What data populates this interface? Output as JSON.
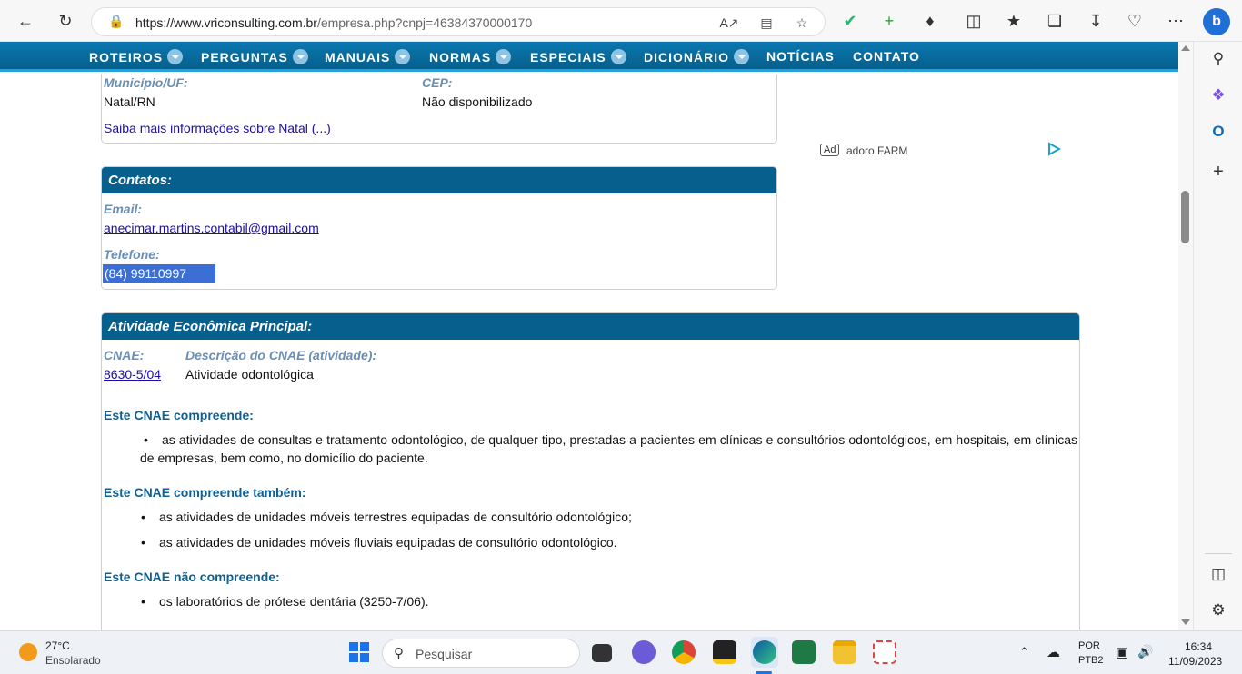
{
  "browser": {
    "url_host": "https://www.vriconsulting.com.br",
    "url_path": "/empresa.php?cnpj=46384370000170"
  },
  "nav": {
    "items": [
      {
        "label": "ROTEIROS",
        "dropdown": true
      },
      {
        "label": "PERGUNTAS",
        "dropdown": true
      },
      {
        "label": "MANUAIS",
        "dropdown": true
      },
      {
        "label": "NORMAS",
        "dropdown": true
      },
      {
        "label": "ESPECIAIS",
        "dropdown": true
      },
      {
        "label": "DICIONÁRIO",
        "dropdown": true
      },
      {
        "label": "NOTÍCIAS",
        "dropdown": false
      },
      {
        "label": "CONTATO",
        "dropdown": false
      }
    ]
  },
  "address": {
    "municipio_label": "Município/UF:",
    "municipio_value": "Natal/RN",
    "cep_label": "CEP:",
    "cep_value": "Não disponibilizado",
    "more_link": "Saiba mais informações sobre Natal (...)"
  },
  "contacts": {
    "title": "Contatos:",
    "email_label": "Email:",
    "email_value": "anecimar.martins.contabil@gmail.com",
    "phone_label": "Telefone:",
    "phone_value": "(84) 99110997"
  },
  "activity": {
    "title": "Atividade Econômica Principal:",
    "cnae_label": "CNAE:",
    "desc_label": "Descrição do CNAE (atividade):",
    "cnae_value": "8630-5/04",
    "desc_value": "Atividade odontológica",
    "comprises_title": "Este CNAE compreende:",
    "comprises": [
      "as atividades de consultas e tratamento odontológico, de qualquer tipo, prestadas a pacientes em clínicas e consultórios odontológicos, em hospitais, em clínicas de empresas, bem como, no domicílio do paciente."
    ],
    "also_title": "Este CNAE compreende também:",
    "also": [
      "as atividades de unidades móveis terrestres equipadas de consultório odontológico;",
      "as atividades de unidades móveis fluviais equipadas de consultório odontológico."
    ],
    "not_title": "Este CNAE não compreende:",
    "not": [
      "os laboratórios de prótese dentária (3250-7/06)."
    ]
  },
  "ad": {
    "tag": "Ad",
    "text": "adoro FARM"
  },
  "taskbar": {
    "temperature": "27°C",
    "weather": "Ensolarado",
    "search_placeholder": "Pesquisar",
    "lang": "POR",
    "layout": "PTB2",
    "time": "16:34",
    "date": "11/09/2023"
  }
}
